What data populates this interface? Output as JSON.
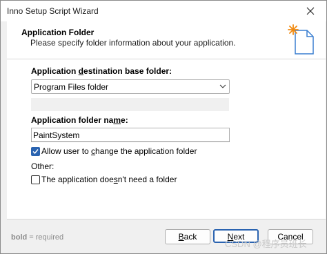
{
  "window": {
    "title": "Inno Setup Script Wizard"
  },
  "header": {
    "title": "Application Folder",
    "subtitle": "Please specify folder information about your application."
  },
  "form": {
    "dest_label_pre": "Application ",
    "dest_label_key": "d",
    "dest_label_post": "estination base folder:",
    "dest_value": "Program Files folder",
    "name_label_pre": "Application folder na",
    "name_label_key": "m",
    "name_label_post": "e:",
    "name_value": "PaintSystem",
    "allow_change_pre": "Allow user to ",
    "allow_change_key": "c",
    "allow_change_post": "hange the application folder",
    "allow_change_checked": true,
    "other_label": "Other:",
    "no_folder_pre": "The application doe",
    "no_folder_key": "s",
    "no_folder_post": "n't need a folder",
    "no_folder_checked": false
  },
  "footer": {
    "note_bold": "bold",
    "note_rest": " = required",
    "back_key": "B",
    "back_rest": "ack",
    "next_key": "N",
    "next_rest": "ext",
    "cancel_label": "Cancel"
  },
  "watermark": "CSDN @程序员班长",
  "colors": {
    "accent": "#2a63b0",
    "window_bg": "#f0f0f0"
  },
  "icons": {
    "close": "close-icon",
    "wizard": "wizard-document-icon",
    "dropdown": "chevron-down-icon",
    "check": "checkmark-icon"
  }
}
